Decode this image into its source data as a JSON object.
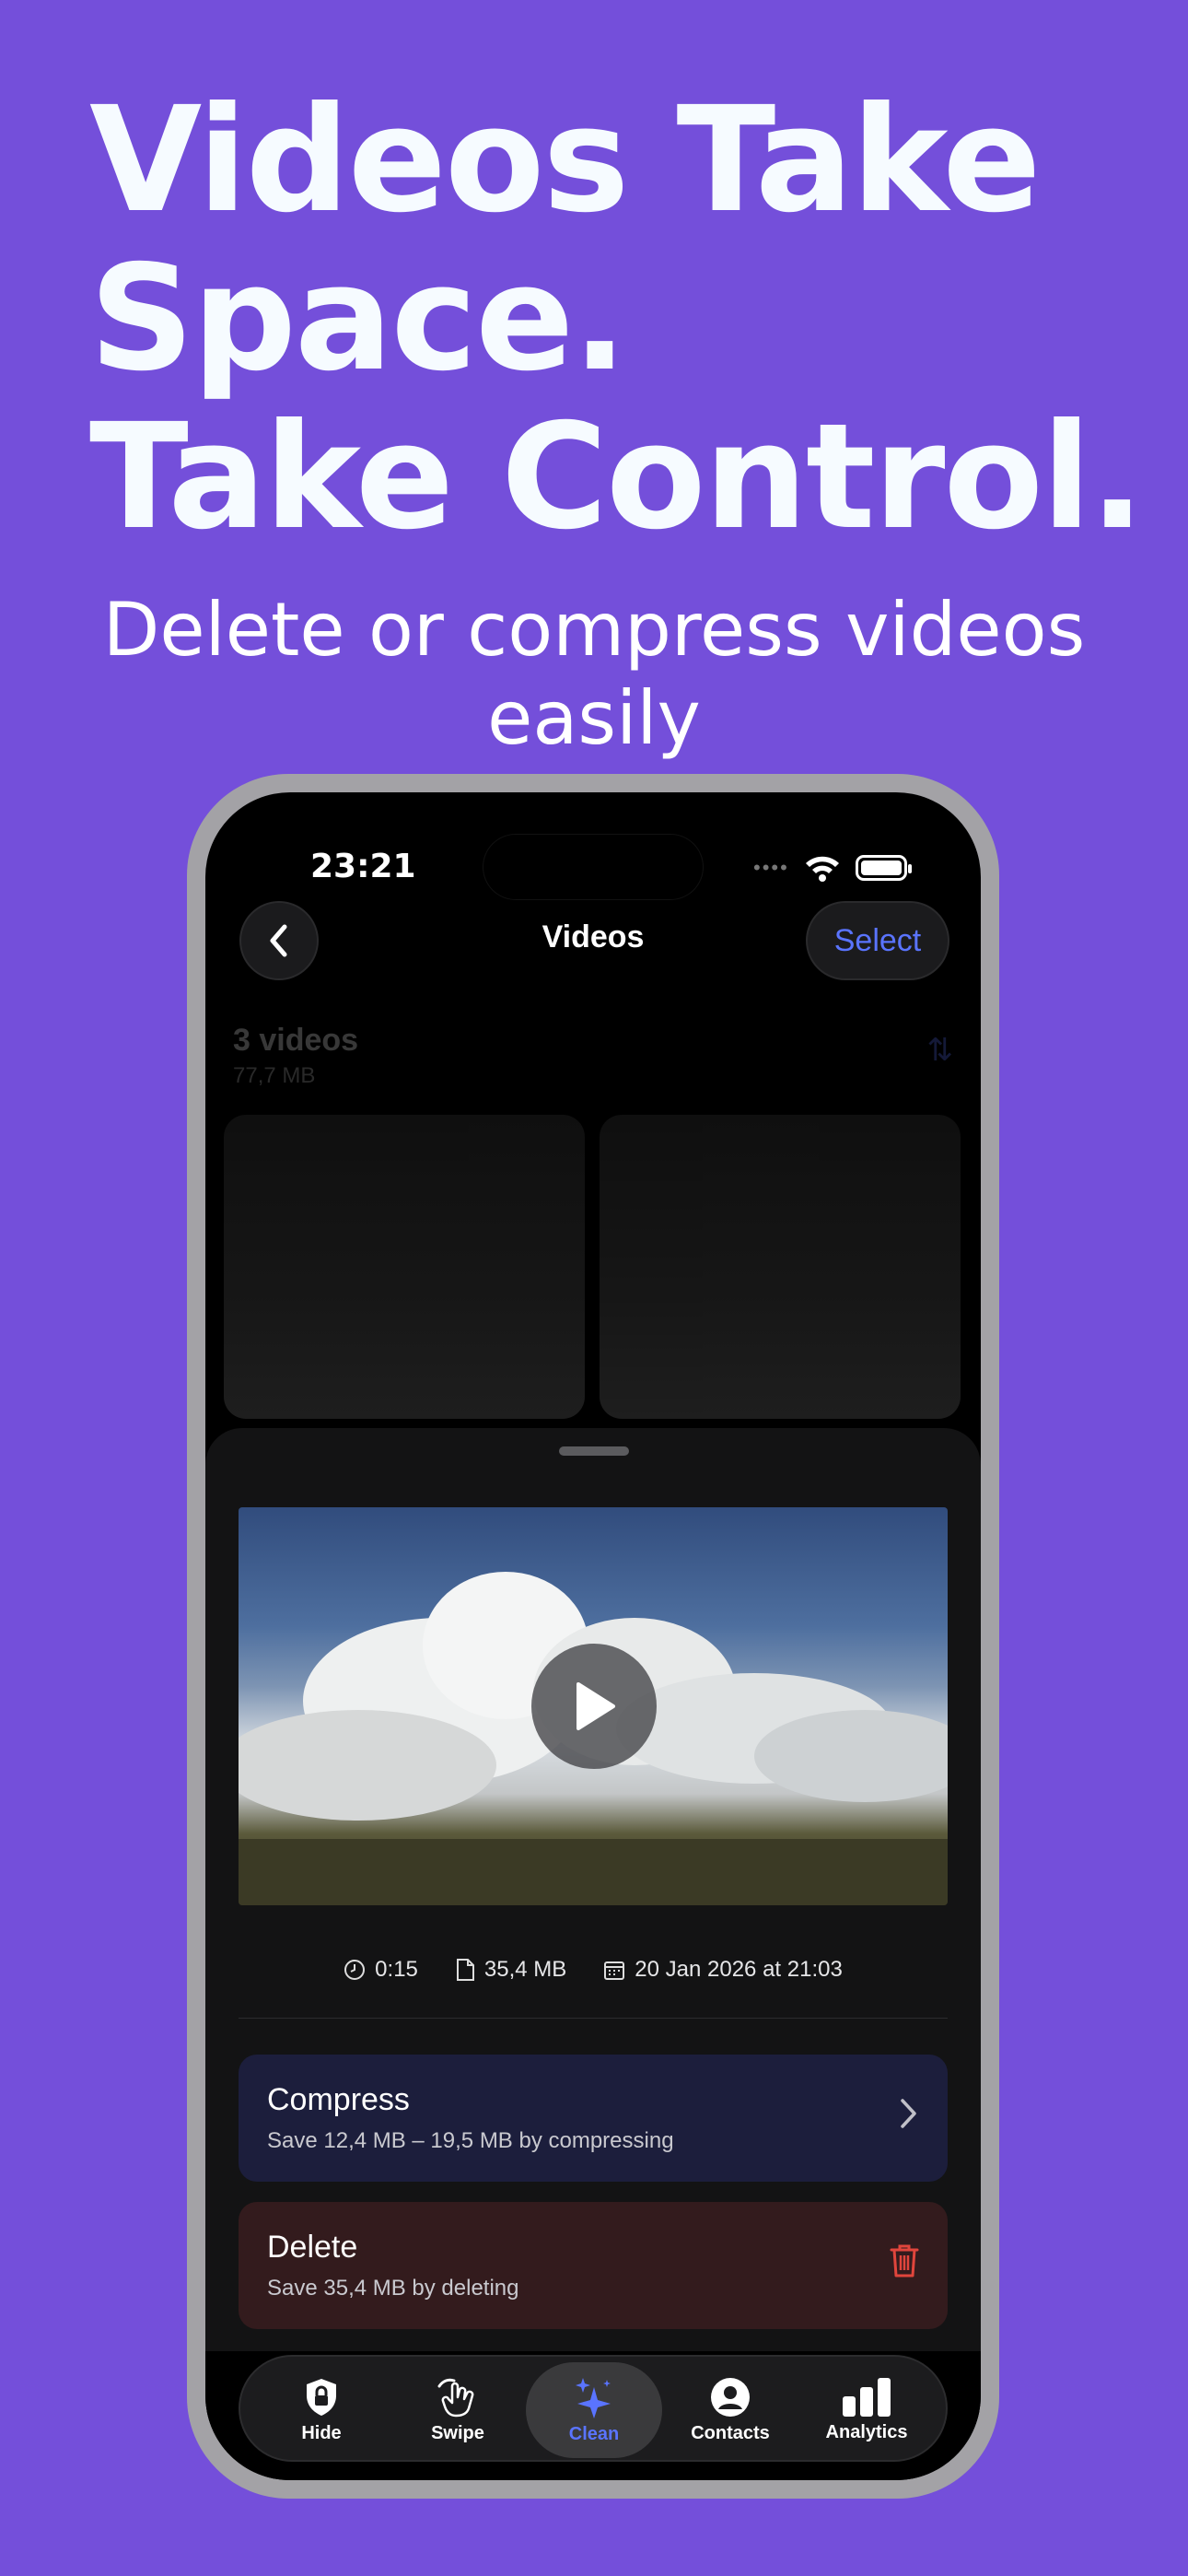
{
  "promo": {
    "headline_lines": [
      "Videos Take",
      "Space.",
      "Take Control."
    ],
    "subhead": "Delete or compress videos easily"
  },
  "status_bar": {
    "time": "23:21"
  },
  "nav": {
    "title": "Videos",
    "select_label": "Select"
  },
  "library": {
    "count_label": "3 videos",
    "size_label": "77,7 MB"
  },
  "video": {
    "duration": "0:15",
    "size": "35,4 MB",
    "date": "20 Jan 2026 at 21:03"
  },
  "actions": {
    "compress": {
      "title": "Compress",
      "subtitle": "Save 12,4 MB – 19,5 MB by compressing"
    },
    "delete": {
      "title": "Delete",
      "subtitle": "Save 35,4 MB by deleting"
    }
  },
  "tabs": [
    {
      "label": "Hide",
      "icon": "shield-lock-icon"
    },
    {
      "label": "Swipe",
      "icon": "hand-swipe-icon"
    },
    {
      "label": "Clean",
      "icon": "sparkles-icon",
      "active": true
    },
    {
      "label": "Contacts",
      "icon": "person-circle-icon"
    },
    {
      "label": "Analytics",
      "icon": "bar-chart-icon"
    }
  ],
  "colors": {
    "background": "#744fda",
    "accent": "#5a74ff",
    "delete_icon": "#e0453c"
  }
}
